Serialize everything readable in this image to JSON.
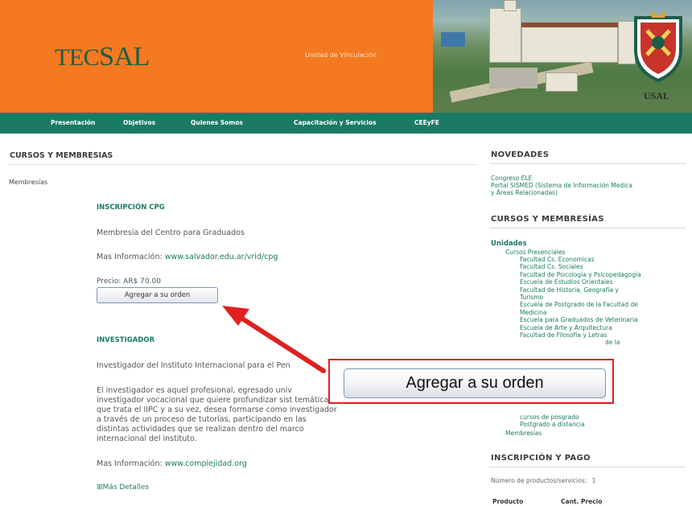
{
  "header": {
    "logo_text_a": "TEC",
    "logo_text_b": "SAL",
    "unit_label": "Unidad de Vinculación",
    "crest_caption": "USAL",
    "accent_color": "#f47920",
    "brand_green": "#1b7a64"
  },
  "nav": {
    "items": [
      "Presentación",
      "Objetivos",
      "Quienes Somos",
      "Capacitación y Servicios",
      "CEEyFE"
    ]
  },
  "main": {
    "title": "CURSOS Y MEMBRESIAS",
    "side_label": "Membresías",
    "cpg": {
      "title": "INSCRIPCIÓN CPG",
      "description": "Membresía del Centro para Graduados",
      "more_info_label": "Mas Información:",
      "more_info_link": "www.salvador.edu.ar/vrid/cpg",
      "price": "Precio: AR$ 70.00",
      "add_button": "Agregar a su orden"
    },
    "investigador": {
      "title": "INVESTIGADOR",
      "description": "Investigador del Instituto Internacional para el Pen",
      "paragraph": "El investigador es aquel profesional, egresado univ investigador vocacional que quiere profundizar sist temáticas que trata el IIPC y a su vez, desea formarse como investigador a través de un proceso de tutorías, participando en las distintas actividades que se realizan dentro del marco internacional del instituto.",
      "more_info_label": "Mas Información:",
      "more_info_link": "www.complejidad.org",
      "more_details": "⊞Más Detalles"
    }
  },
  "sidebar": {
    "novedades": {
      "title": "NOVEDADES",
      "links": [
        "Congreso ELE",
        "Portal SISMED (Sistema de Información Medica",
        "y Áreas Relacionadas)"
      ]
    },
    "cursos": {
      "title": "CURSOS Y MEMBRESÍAS",
      "unidades": "Unidades",
      "presenciales": "Cursos Presenciales",
      "facultades": [
        "Facultad Cs. Economicas",
        "Facultad Cs. Sociales",
        "Facultad de Psicología y Psicopedagogía",
        "Escuela de Estudios Orientales",
        "Facultad de Historia, Geografía y",
        "Turismo",
        "Escuela de Postgrado de la Facultad de",
        "Medicina",
        "Escuela para Graduados de Veterinaria",
        "Escuela de Arte y Arquitectura",
        "Facultad de Filosofía y Letras",
        "de la"
      ],
      "tail": [
        "cursos de posgrado",
        "Postgrado a distancia"
      ],
      "membresias": "Membresías"
    },
    "pago": {
      "title": "INSCRIPCIÓN Y PAGO",
      "count_label": "Número de productos/servicios:",
      "count": "1",
      "col_producto": "Producto",
      "col_cant": "Cant. Precio"
    }
  },
  "callout": {
    "zoom_button": "Agregar a su orden",
    "highlight_color": "#e02020"
  }
}
